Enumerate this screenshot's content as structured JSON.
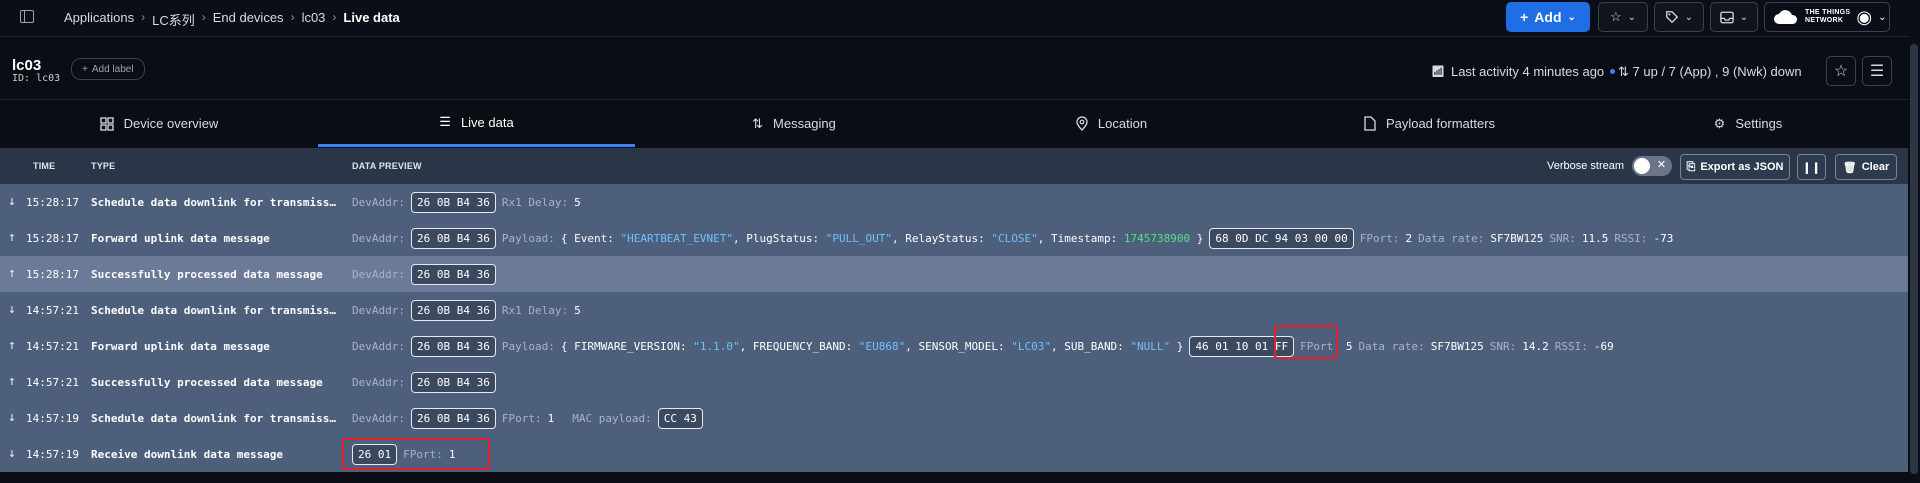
{
  "topbar": {
    "breadcrumb": [
      "Applications",
      "LC系列",
      "End devices",
      "lc03",
      "Live data"
    ],
    "add_label": "Add",
    "brand_line1": "THE THINGS",
    "brand_line2": "NETWORK"
  },
  "device": {
    "name": "lc03",
    "id_text": "ID: lc03",
    "add_label": "Add label",
    "last_activity": "Last activity 4 minutes ago",
    "traffic": "7 up / 7 (App) , 9 (Nwk) down"
  },
  "tabs": [
    {
      "label": "Device overview",
      "icon": "grid-icon"
    },
    {
      "label": "Live data",
      "icon": "list-icon",
      "active": true
    },
    {
      "label": "Messaging",
      "icon": "arrows-up-down-icon"
    },
    {
      "label": "Location",
      "icon": "location-pin-icon"
    },
    {
      "label": "Payload formatters",
      "icon": "code-file-icon"
    },
    {
      "label": "Settings",
      "icon": "gear-icon"
    }
  ],
  "table": {
    "col_time": "TIME",
    "col_type": "TYPE",
    "col_preview": "DATA PREVIEW",
    "verbose_label": "Verbose stream",
    "export_label": "Export as JSON",
    "clear_label": "Clear"
  },
  "labels": {
    "devaddr": "DevAddr:",
    "rx1": "Rx1 Delay:",
    "payload": "Payload:",
    "fport": "FPort:",
    "datarate": "Data rate:",
    "snr": "SNR:",
    "rssi": "RSSI:",
    "mac": "MAC payload:"
  },
  "rows": [
    {
      "dir": "down",
      "time": "15:28:17",
      "type": "Schedule data downlink for transmissi…",
      "devaddr": "26 0B B4 36",
      "rx1": "5"
    },
    {
      "dir": "up",
      "time": "15:28:17",
      "type": "Forward uplink data message",
      "devaddr": "26 0B B4 36",
      "payload": {
        "k1": "Event:",
        "v1": "\"HEARTBEAT_EVNET\"",
        "k2": "PlugStatus:",
        "v2": "\"PULL_OUT\"",
        "k3": "RelayStatus:",
        "v3": "\"CLOSE\"",
        "k4": "Timestamp:",
        "v4": "1745738900"
      },
      "bytes": "68 0D DC 94 03 00 00",
      "fport": "2",
      "datarate": "SF7BW125",
      "snr": "11.5",
      "rssi": "-73"
    },
    {
      "dir": "up",
      "time": "15:28:17",
      "type": "Successfully processed data message",
      "devaddr": "26 0B B4 36"
    },
    {
      "dir": "down",
      "time": "14:57:21",
      "type": "Schedule data downlink for transmissi…",
      "devaddr": "26 0B B4 36",
      "rx1": "5"
    },
    {
      "dir": "up",
      "time": "14:57:21",
      "type": "Forward uplink data message",
      "devaddr": "26 0B B4 36",
      "payload": {
        "k1": "FIRMWARE_VERSION:",
        "v1": "\"1.1.0\"",
        "k2": "FREQUENCY_BAND:",
        "v2": "\"EU868\"",
        "k3": "SENSOR_MODEL:",
        "v3": "\"LC03\"",
        "k4": "SUB_BAND:",
        "v4": "\"NULL\""
      },
      "bytes": "46 01 10 01 FF",
      "fport": "5",
      "datarate": "SF7BW125",
      "snr": "14.2",
      "rssi": "-69"
    },
    {
      "dir": "up",
      "time": "14:57:21",
      "type": "Successfully processed data message",
      "devaddr": "26 0B B4 36"
    },
    {
      "dir": "down",
      "time": "14:57:19",
      "type": "Schedule data downlink for transmissi…",
      "devaddr": "26 0B B4 36",
      "fport": "1",
      "mac": "CC 43"
    },
    {
      "dir": "down",
      "time": "14:57:19",
      "type": "Receive downlink data message",
      "bytes": "26 01",
      "fport": "1"
    }
  ],
  "colors": {
    "accent": "#1f6ee6",
    "row_bg": "#4e5f7c",
    "row_highlight": "#6b7a97",
    "annotation": "#e0202a"
  }
}
